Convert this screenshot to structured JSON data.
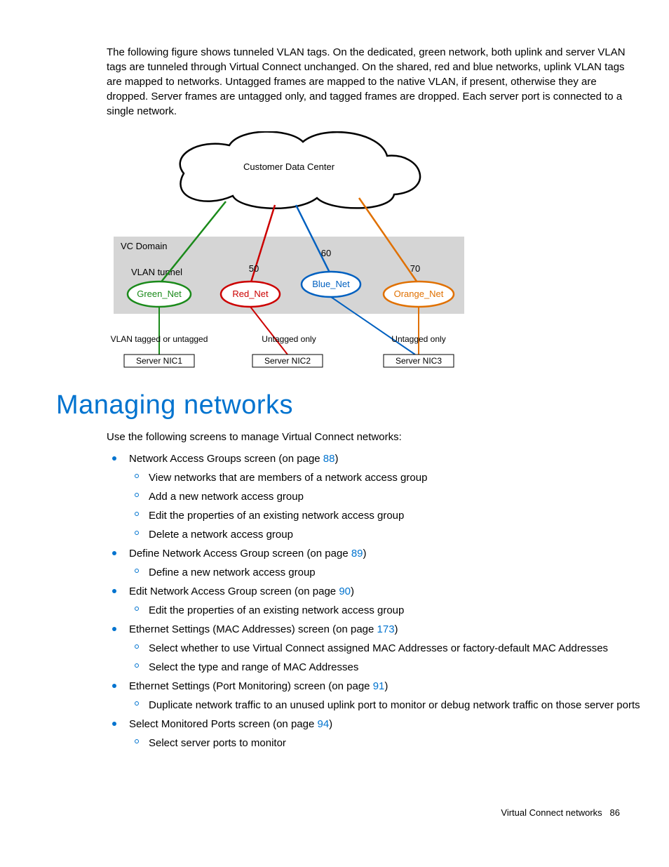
{
  "intro": "The following figure shows tunneled VLAN tags. On the dedicated, green network, both uplink and server VLAN tags are tunneled through Virtual Connect unchanged. On the shared, red and blue networks, uplink VLAN tags are mapped to networks. Untagged frames are mapped to the native VLAN, if present, otherwise they are dropped. Server frames are untagged only, and tagged frames are dropped. Each server port is connected to a single network.",
  "figure": {
    "cdc": "Customer Data Center",
    "vc_domain": "VC Domain",
    "vlan_tunnel": "VLAN tunnel",
    "green": "Green_Net",
    "red": "Red_Net",
    "blue": "Blue_Net",
    "orange": "Orange_Net",
    "n50": "50",
    "n60": "60",
    "n70": "70",
    "tag1": "VLAN tagged or untagged",
    "tag2": "Untagged only",
    "tag3": "Untagged only",
    "nic1": "Server NIC1",
    "nic2": "Server NIC2",
    "nic3": "Server NIC3"
  },
  "heading": "Managing networks",
  "lead": "Use the following screens to manage Virtual Connect networks:",
  "list": [
    {
      "pre": "Network Access Groups screen (on page ",
      "link": "88",
      "post": ")",
      "sub": [
        "View networks that are members of a network access group",
        "Add a new network access group",
        "Edit the properties of an existing network access group",
        "Delete a network access group"
      ]
    },
    {
      "pre": "Define Network Access Group screen (on page ",
      "link": "89",
      "post": ")",
      "sub": [
        "Define a new network access group"
      ]
    },
    {
      "pre": "Edit Network Access Group screen (on page ",
      "link": "90",
      "post": ")",
      "sub": [
        "Edit the properties of an existing network access group"
      ]
    },
    {
      "pre": "Ethernet Settings (MAC Addresses) screen (on page ",
      "link": "173",
      "post": ")",
      "sub": [
        "Select whether to use Virtual Connect assigned MAC Addresses or factory-default MAC Addresses",
        "Select the type and range of MAC Addresses"
      ]
    },
    {
      "pre": "Ethernet Settings (Port Monitoring) screen (on page ",
      "link": "91",
      "post": ")",
      "sub": [
        "Duplicate network traffic to an unused uplink port to monitor or debug network traffic on those server ports"
      ]
    },
    {
      "pre": "Select Monitored Ports screen (on page ",
      "link": "94",
      "post": ")",
      "sub": [
        "Select server ports to monitor"
      ]
    }
  ],
  "footer": {
    "section": "Virtual Connect networks",
    "page": "86"
  }
}
